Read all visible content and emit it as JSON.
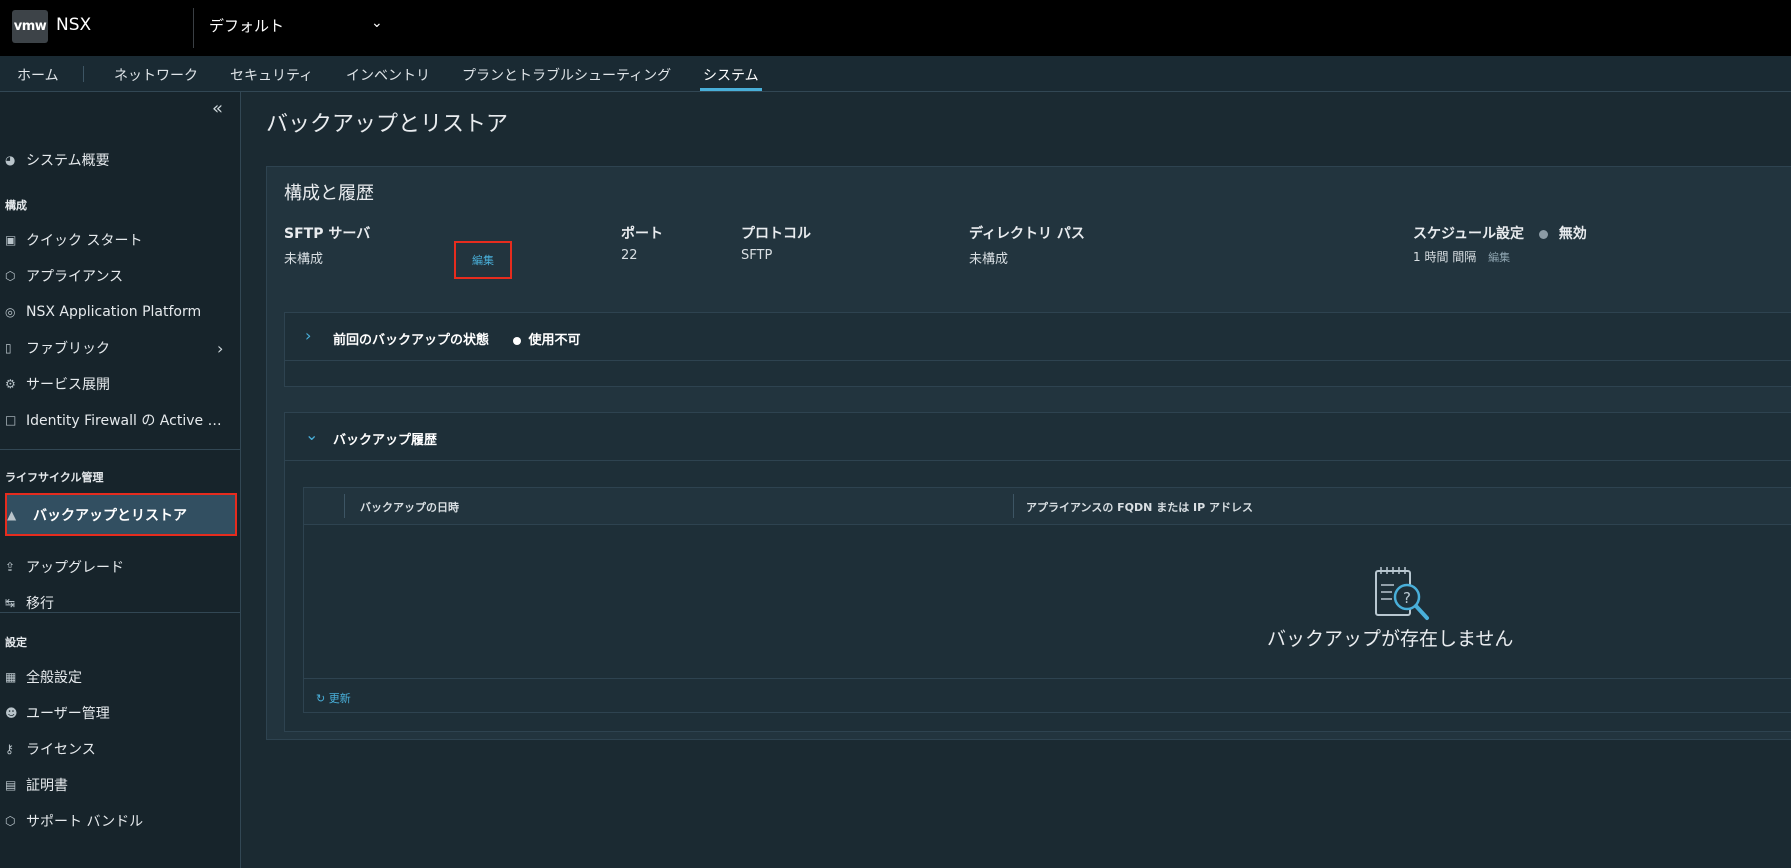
{
  "header": {
    "logo": "vmw",
    "app_name": "NSX",
    "context": "デフォルト"
  },
  "nav": {
    "items": [
      "ホーム",
      "ネットワーク",
      "セキュリティ",
      "インベントリ",
      "プランとトラブルシューティング",
      "システム"
    ],
    "active": "システム"
  },
  "sidebar": {
    "overview": "システム概要",
    "section_config": "構成",
    "config_items": [
      "クイック スタート",
      "アプライアンス",
      "NSX Application Platform",
      "ファブリック",
      "サービス展開",
      "Identity Firewall の Active Di..."
    ],
    "section_lifecycle": "ライフサイクル管理",
    "lifecycle_items": [
      "バックアップとリストア",
      "アップグレード",
      "移行"
    ],
    "section_settings": "設定",
    "settings_items": [
      "全般設定",
      "ユーザー管理",
      "ライセンス",
      "証明書",
      "サポート バンドル"
    ]
  },
  "main": {
    "page_title": "バックアップとリストア",
    "card_title": "構成と履歴",
    "sftp_label": "SFTP サーバ",
    "sftp_value": "未構成",
    "edit_label": "編集",
    "port_label": "ポート",
    "port_value": "22",
    "protocol_label": "プロトコル",
    "protocol_value": "SFTP",
    "dir_label": "ディレクトリ パス",
    "dir_value": "未構成",
    "schedule_label": "スケジュール設定",
    "schedule_status": "無効",
    "schedule_interval": "1 時間 間隔",
    "schedule_edit": "編集",
    "last_backup_title": "前回のバックアップの状態",
    "last_backup_status": "使用不可",
    "history_title": "バックアップ履歴",
    "col_datetime": "バックアップの日時",
    "col_fqdn": "アプライアンスの FQDN または IP アドレス",
    "empty_text": "バックアップが存在しません",
    "refresh_label": "更新"
  },
  "colors": {
    "accent": "#49afd9",
    "highlight_border": "#e62c1e",
    "disabled_dot": "#8c9ba5",
    "unavailable_dot": "#ffffff"
  }
}
